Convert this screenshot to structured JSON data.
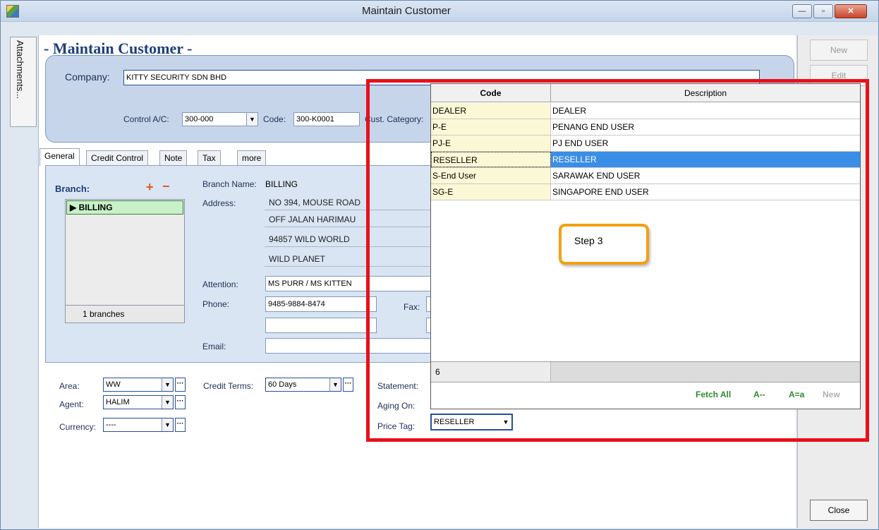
{
  "window": {
    "title": "Maintain Customer",
    "attachments_label": "Attachments...",
    "min_glyph": "—",
    "max_glyph": "▫",
    "close_glyph": "✕"
  },
  "form": {
    "title": "- Maintain Customer -",
    "company_label": "Company:",
    "company_value": "KITTY SECURITY SDN BHD",
    "control_ac_label": "Control A/C:",
    "control_ac_value": "300-000",
    "code_label": "Code:",
    "code_value": "300-K0001",
    "cust_category_label": "Cust. Category:"
  },
  "tabs": [
    {
      "label": "General"
    },
    {
      "label": "Credit Control"
    },
    {
      "label": "Note"
    },
    {
      "label": "Tax"
    },
    {
      "label": "more"
    }
  ],
  "branch": {
    "title": "Branch:",
    "add_glyph": "+",
    "remove_glyph": "−",
    "items": [
      "BILLING"
    ],
    "count_text": "1 branches",
    "branch_name_label": "Branch Name:",
    "branch_name_value": "BILLING",
    "address_label": "Address:",
    "address_lines": [
      "NO 394, MOUSE ROAD",
      "OFF JALAN HARIMAU",
      "94857 WILD WORLD",
      "WILD PLANET"
    ],
    "attention_label": "Attention:",
    "attention_value": "MS PURR / MS KITTEN",
    "phone_label": "Phone:",
    "phone_value": "9485-9884-8474",
    "phone2_value": "",
    "fax_label": "Fax:",
    "email_label": "Email:",
    "email_value": ""
  },
  "bottom": {
    "area_label": "Area:",
    "area_value": "WW",
    "agent_label": "Agent:",
    "agent_value": "HALIM",
    "currency_label": "Currency:",
    "currency_value": "----",
    "credit_terms_label": "Credit Terms:",
    "credit_terms_value": "60 Days",
    "statement_label": "Statement:",
    "aging_label": "Aging On:",
    "price_tag_label": "Price Tag:",
    "price_tag_value": "RESELLER"
  },
  "right_bar": {
    "new_label": "New",
    "edit_label": "Edit",
    "close_label": "Close"
  },
  "lookup": {
    "col_code": "Code",
    "col_description": "Description",
    "rows": [
      {
        "code": "DEALER",
        "description": "DEALER"
      },
      {
        "code": "P-E",
        "description": "PENANG END USER"
      },
      {
        "code": "PJ-E",
        "description": "PJ END USER"
      },
      {
        "code": "RESELLER",
        "description": "RESELLER"
      },
      {
        "code": "S-End User",
        "description": "SARAWAK END USER"
      },
      {
        "code": "SG-E",
        "description": "SINGAPORE END USER"
      }
    ],
    "selected_code": "RESELLER",
    "count": "6",
    "fetch_all": "Fetch All",
    "case_upper": "A--",
    "case_match": "A=a",
    "new_label": "New"
  },
  "annotation": {
    "step_text": "Step 3",
    "frame_color": "#e8101a",
    "callout_color": "#f2a014"
  },
  "colors": {
    "accent": "#1f3f79",
    "selection": "#3a8ee6",
    "code_cell": "#fbf8d6",
    "fetch_green": "#2d8b2d"
  }
}
